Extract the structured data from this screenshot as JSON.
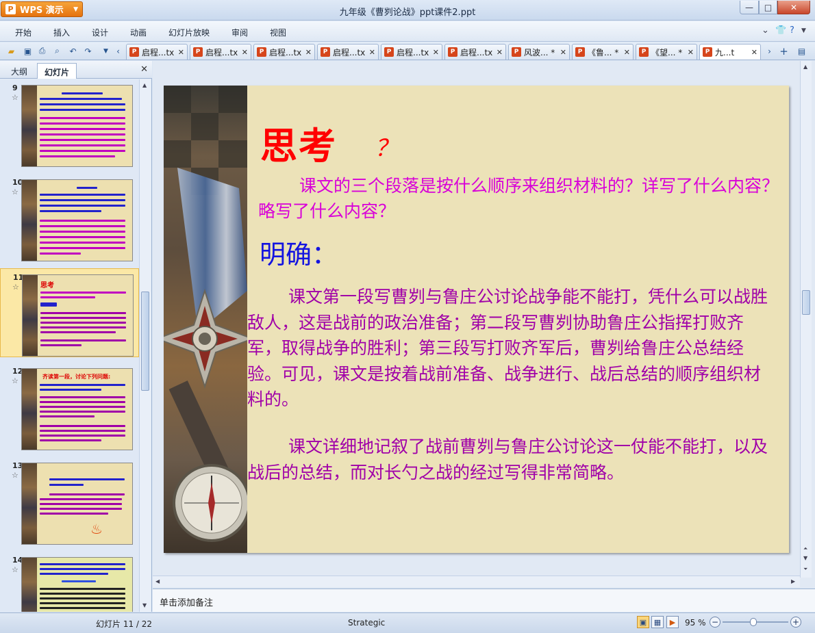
{
  "app": {
    "menu_button": "WPS 演示",
    "window_title": "九年级《曹刿论战》ppt课件2.ppt"
  },
  "menu": [
    "开始",
    "插入",
    "设计",
    "动画",
    "幻灯片放映",
    "审阅",
    "视图"
  ],
  "doc_tabs": [
    {
      "label": "启程...tx"
    },
    {
      "label": "启程...tx"
    },
    {
      "label": "启程...tx"
    },
    {
      "label": "启程...tx"
    },
    {
      "label": "启程...tx"
    },
    {
      "label": "启程...tx"
    },
    {
      "label": "风波... *"
    },
    {
      "label": "《鲁... *"
    },
    {
      "label": "《望... *"
    },
    {
      "label": "九...t"
    }
  ],
  "left_panel": {
    "tab_outline": "大纲",
    "tab_slides": "幻灯片",
    "thumbnails": [
      {
        "number": "9",
        "title": ""
      },
      {
        "number": "10",
        "title": ""
      },
      {
        "number": "11",
        "title": "思考"
      },
      {
        "number": "12",
        "title": "齐读第一段，讨论下列问题:"
      },
      {
        "number": "13",
        "title": ""
      },
      {
        "number": "14",
        "title": ""
      }
    ],
    "current_index": 2
  },
  "slide": {
    "title": "思考",
    "question_mark": "？",
    "question": "课文的三个段落是按什么顺序来组织材料的？详写了什么内容？略写了什么内容？",
    "answer_heading": "明确：",
    "answer_p1": "课文第一段写曹刿与鲁庄公讨论战争能不能打，凭什么可以战胜敌人，这是战前的政治准备；第二段写曹刿协助鲁庄公指挥打败齐军，取得战争的胜利；第三段写打败齐军后，曹刿给鲁庄公总结经验。可见，课文是按着战前准备、战争进行、战后总结的顺序组织材料的。",
    "answer_p2": "课文详细地记叙了战前曹刿与鲁庄公讨论这一仗能不能打，以及战后的总结，而对长勺之战的经过写得非常简略。"
  },
  "notes_placeholder": "单击添加备注",
  "status": {
    "slide_counter": "幻灯片 11 / 22",
    "theme": "Strategic",
    "zoom": "95 %",
    "zoom_percent": 95
  },
  "colors": {
    "title_red": "#ff0000",
    "question_magenta": "#d800d8",
    "heading_blue": "#1414e0",
    "answer_purple": "#a000a8",
    "slide_bg": "#ece2b8",
    "wps_orange": "#e5720e"
  }
}
